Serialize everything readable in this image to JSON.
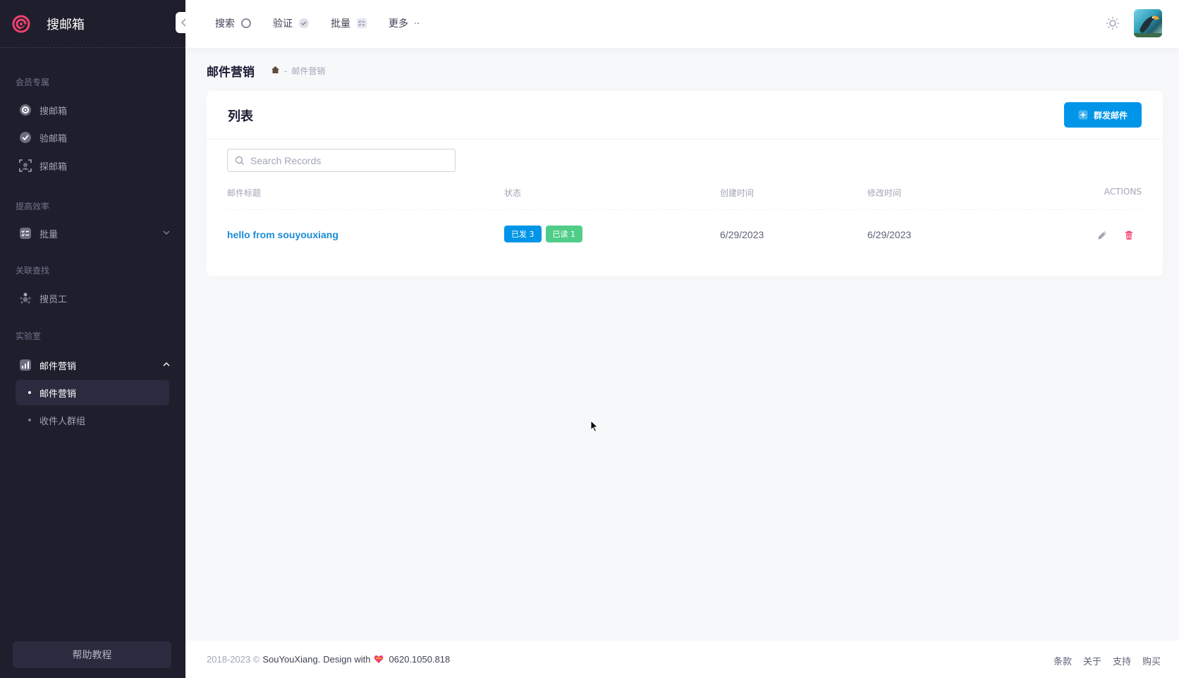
{
  "app": {
    "brand": "搜邮箱"
  },
  "sidebar": {
    "sections": [
      {
        "title": "会员专属",
        "items": [
          {
            "label": "搜邮箱",
            "icon": "search-mail-icon"
          },
          {
            "label": "验邮箱",
            "icon": "check-circle-icon"
          },
          {
            "label": "探邮箱",
            "icon": "scan-icon"
          }
        ]
      },
      {
        "title": "提高效率",
        "items": [
          {
            "label": "批量",
            "icon": "list-check-icon"
          }
        ]
      },
      {
        "title": "关联查找",
        "items": [
          {
            "label": "搜员工",
            "icon": "people-icon"
          }
        ]
      },
      {
        "title": "实验室",
        "items": [
          {
            "label": "邮件营销",
            "icon": "chart-icon"
          }
        ]
      }
    ],
    "submenu": [
      {
        "label": "邮件营销",
        "active": true
      },
      {
        "label": "收件人群组",
        "active": false
      }
    ],
    "help": "帮助教程"
  },
  "topnav": [
    {
      "label": "搜索"
    },
    {
      "label": "验证"
    },
    {
      "label": "批量"
    },
    {
      "label": "更多"
    }
  ],
  "page": {
    "title": "邮件营销",
    "breadcrumb": {
      "separator": "-",
      "current": "邮件营销"
    }
  },
  "card": {
    "title": "列表",
    "send_button": "群发邮件",
    "search_placeholder": "Search Records",
    "columns": [
      "邮件标题",
      "状态",
      "创建时间",
      "修改时间",
      "ACTIONS"
    ],
    "rows": [
      {
        "title": "hello from souyouxiang",
        "sent_badge": "已发 3",
        "read_badge": "已读 1",
        "created": "6/29/2023",
        "modified": "6/29/2023"
      }
    ]
  },
  "footer": {
    "years": "2018-2023 ©",
    "company": "SouYouXiang.",
    "design": "Design with",
    "phone": "0620.1050.818",
    "links": [
      "条款",
      "关于",
      "支持",
      "购买"
    ]
  },
  "colors": {
    "primary": "#0095e8",
    "success": "#50cd89",
    "danger": "#f1416c",
    "sidebar_bg": "#1e1e2d",
    "brand_logo": "#f1416c"
  }
}
